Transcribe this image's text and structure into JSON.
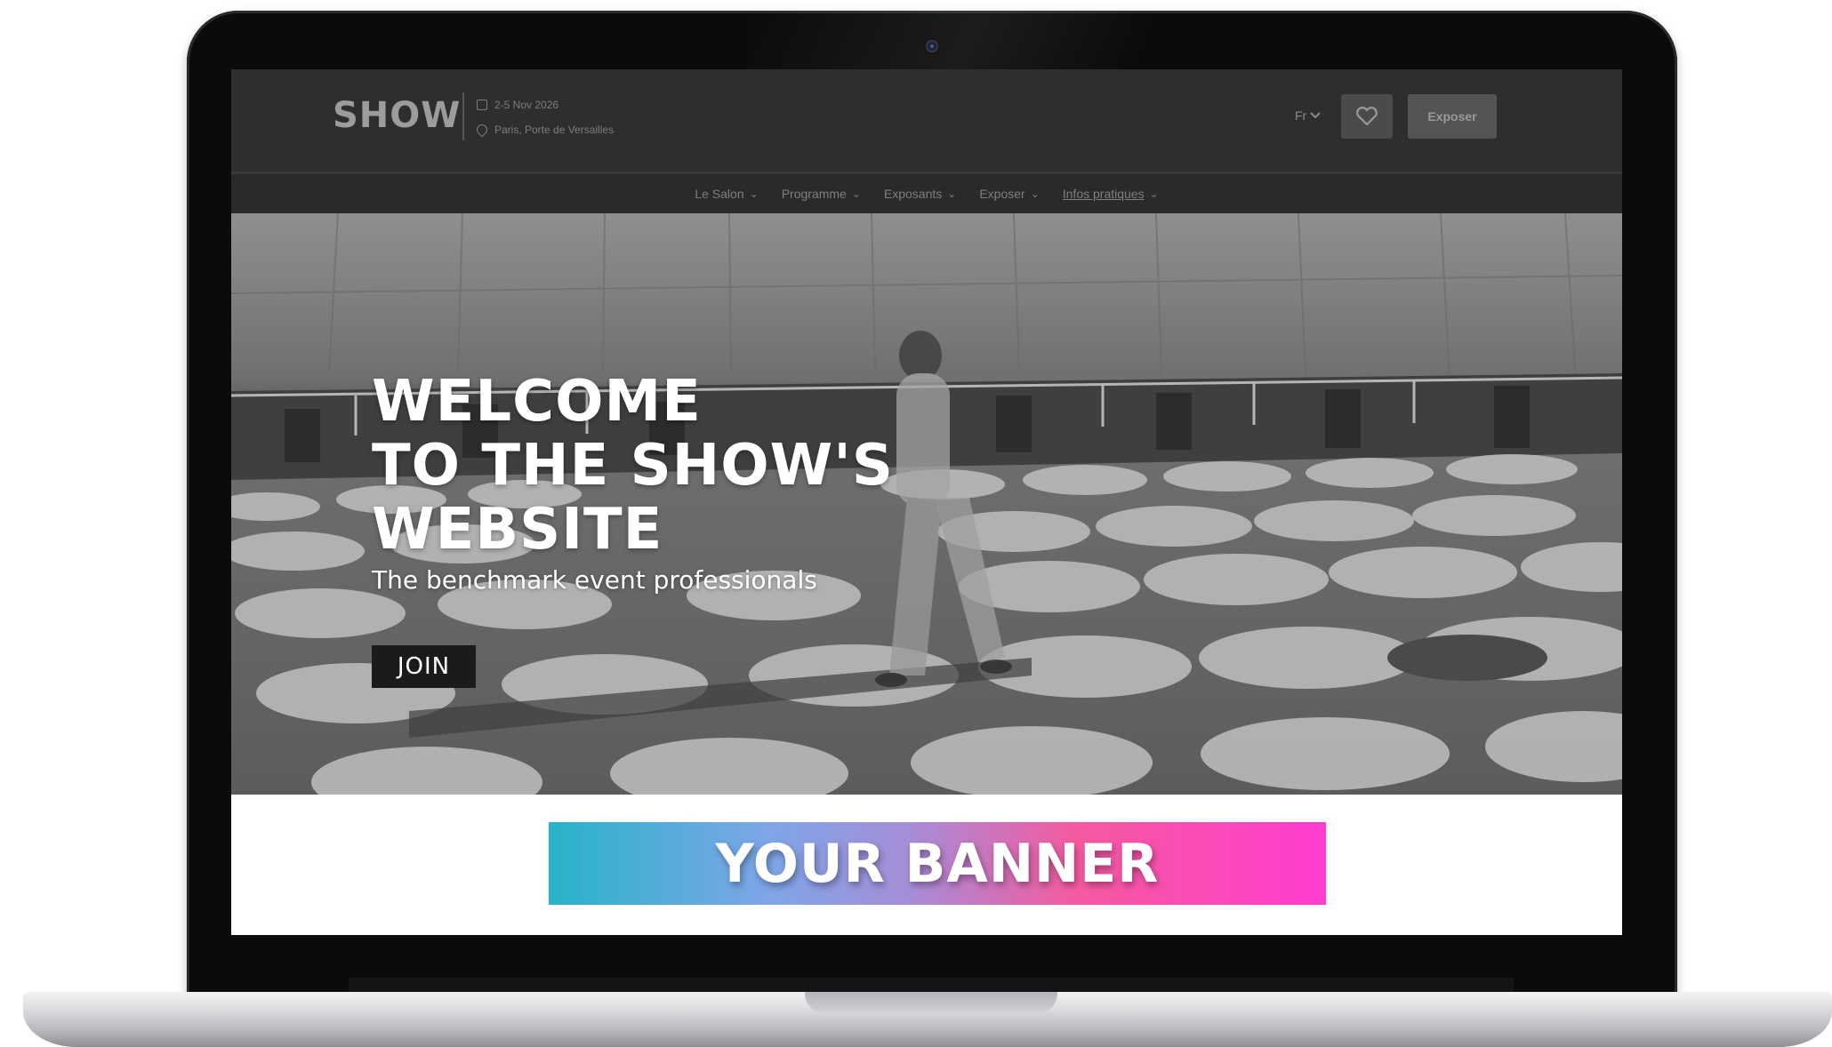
{
  "header": {
    "logo": "SHOW",
    "date": "2-5 Nov 2026",
    "location": "Paris, Porte de Versailles",
    "language": "Fr",
    "favorite_icon": "heart-icon",
    "expose_label": "Exposer"
  },
  "nav": {
    "items": [
      {
        "label": "Le Salon",
        "icon": "chevron-down-icon"
      },
      {
        "label": "Programme",
        "icon": "chevron-down-icon"
      },
      {
        "label": "Exposants",
        "icon": "chevron-down-icon"
      },
      {
        "label": "Exposer",
        "icon": "chevron-down-icon"
      },
      {
        "label": "Infos pratiques",
        "icon": "chevron-down-icon"
      }
    ]
  },
  "hero": {
    "title_lines": [
      "WELCOME",
      "TO THE SHOW'S",
      "WEBSITE"
    ],
    "subtitle": "The benchmark event professionals",
    "cta_label": "JOIN"
  },
  "banner": {
    "text": "YOUR BANNER",
    "gradient_colors": [
      "#27b3c9",
      "#7ea6e8",
      "#a58ed8",
      "#f55a9f",
      "#ff3ccf"
    ]
  },
  "colors": {
    "header_bg": "#2e2e2e",
    "cta_bg": "#1b1b1b",
    "laptop_bezel": "#0b0b0c"
  }
}
